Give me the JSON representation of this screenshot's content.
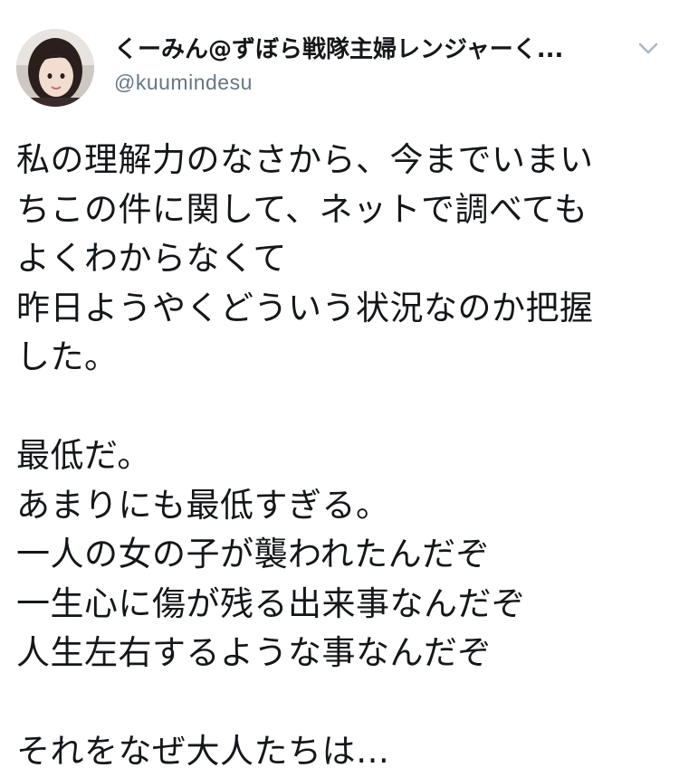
{
  "tweet": {
    "author": {
      "display_name": "くーみん@ずぼら戦隊主婦レンジャーく...",
      "handle": "@kuumindesu",
      "avatar_icon": "profile-photo-icon"
    },
    "menu_icon": "chevron-down-icon",
    "paragraphs": [
      [
        "私の理解力のなさから、今までいまい",
        "ちこの件に関して、ネットで調べても",
        "よくわからなくて",
        "昨日ようやくどういう状況なのか把握",
        "した。"
      ],
      [
        "最低だ。",
        "あまりにも最低すぎる。",
        "一人の女の子が襲われたんだぞ",
        "一生心に傷が残る出来事なんだぞ",
        "人生左右するような事なんだぞ"
      ],
      [
        "それをなぜ大人たちは…"
      ]
    ]
  },
  "colors": {
    "text": "#14171a",
    "secondary_text": "#657786",
    "caret": "#aab8c2",
    "background": "#ffffff"
  }
}
